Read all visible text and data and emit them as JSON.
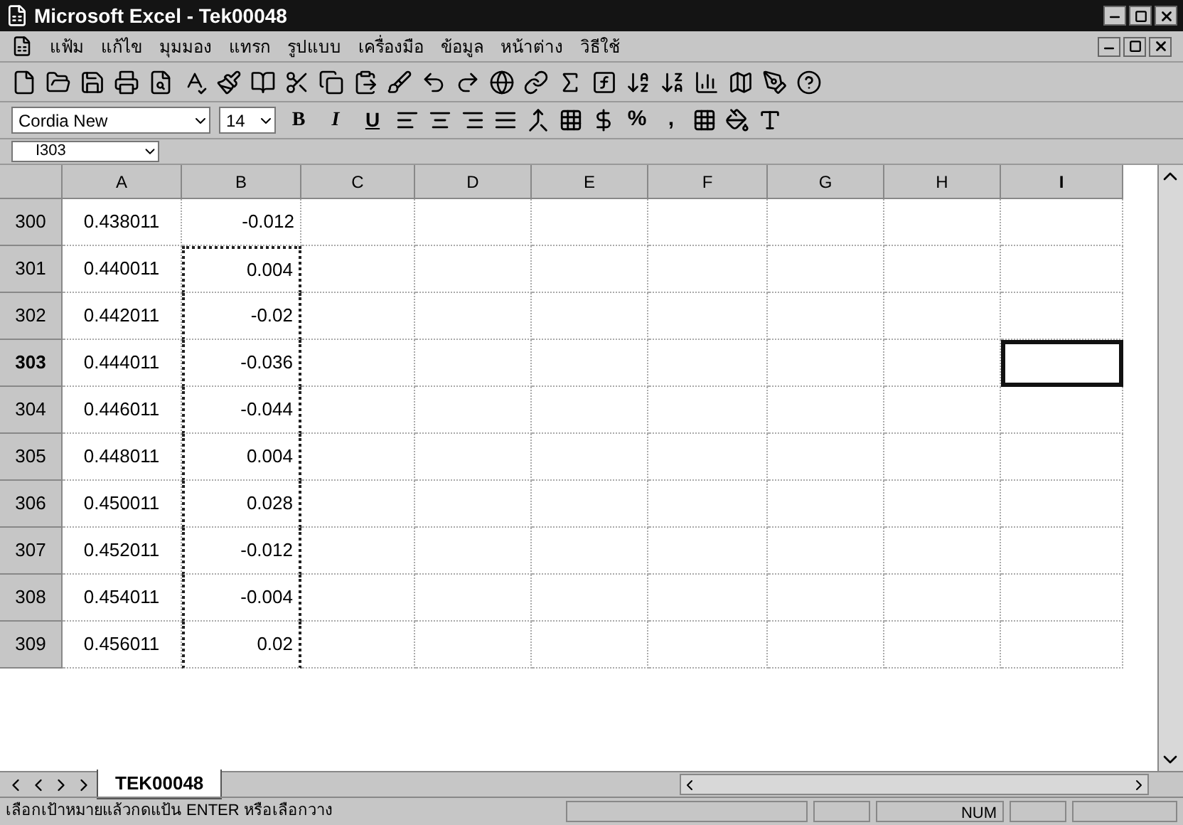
{
  "window": {
    "title": "Microsoft Excel - Tek00048"
  },
  "menu": [
    {
      "label": "แฟ้ม"
    },
    {
      "label": "แก้ไข"
    },
    {
      "label": "มุมมอง"
    },
    {
      "label": "แทรก"
    },
    {
      "label": "รูปแบบ"
    },
    {
      "label": "เครื่องมือ"
    },
    {
      "label": "ข้อมูล"
    },
    {
      "label": "หน้าต่าง"
    },
    {
      "label": "วิธีใช้"
    }
  ],
  "format_bar": {
    "font": "Cordia New",
    "size": "14",
    "style_buttons": [
      "B",
      "I",
      "U"
    ],
    "number_buttons": [
      "%",
      ","
    ]
  },
  "name_box": "I303",
  "columns": [
    {
      "label": "A",
      "selected": false
    },
    {
      "label": "B",
      "selected": false
    },
    {
      "label": "C",
      "selected": false
    },
    {
      "label": "D",
      "selected": false
    },
    {
      "label": "E",
      "selected": false
    },
    {
      "label": "F",
      "selected": false
    },
    {
      "label": "G",
      "selected": false
    },
    {
      "label": "H",
      "selected": false
    },
    {
      "label": "I",
      "selected": true
    }
  ],
  "rows": [
    {
      "header": "300",
      "a": "0.438011",
      "b": "-0.012",
      "selected": false,
      "copied": false
    },
    {
      "header": "301",
      "a": "0.440011",
      "b": "0.004",
      "selected": false,
      "copied": true
    },
    {
      "header": "302",
      "a": "0.442011",
      "b": "-0.02",
      "selected": false,
      "copied": true
    },
    {
      "header": "303",
      "a": "0.444011",
      "b": "-0.036",
      "selected": true,
      "copied": true
    },
    {
      "header": "304",
      "a": "0.446011",
      "b": "-0.044",
      "selected": false,
      "copied": true
    },
    {
      "header": "305",
      "a": "0.448011",
      "b": "0.004",
      "selected": false,
      "copied": true
    },
    {
      "header": "306",
      "a": "0.450011",
      "b": "0.028",
      "selected": false,
      "copied": true
    },
    {
      "header": "307",
      "a": "0.452011",
      "b": "-0.012",
      "selected": false,
      "copied": true
    },
    {
      "header": "308",
      "a": "0.454011",
      "b": "-0.004",
      "selected": false,
      "copied": true
    },
    {
      "header": "309",
      "a": "0.456011",
      "b": "0.02",
      "selected": false,
      "copied": true
    }
  ],
  "sheet_tabs": [
    {
      "label": "TEK00048",
      "selected": true
    }
  ],
  "status_bar": {
    "message": "เลือกเป้าหมายแล้วกดแป้น ENTER หรือเลือกวาง",
    "indicator": "NUM"
  }
}
